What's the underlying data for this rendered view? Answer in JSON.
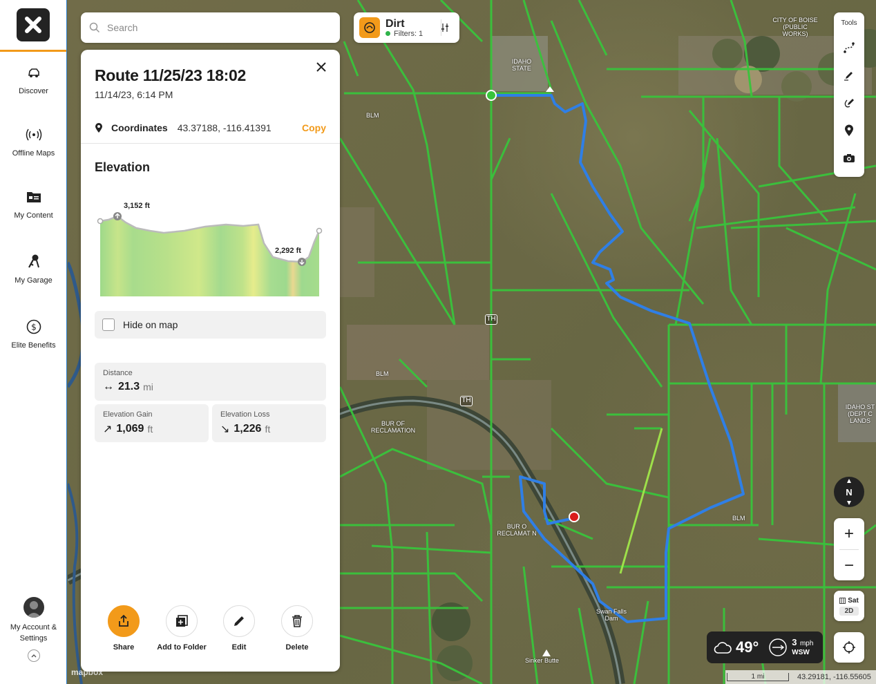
{
  "sidebar": {
    "items": [
      {
        "label": "Discover",
        "icon": "vehicle-discover-icon"
      },
      {
        "label": "Offline Maps",
        "icon": "offline-signal-icon"
      },
      {
        "label": "My Content",
        "icon": "folder-content-icon"
      },
      {
        "label": "My Garage",
        "icon": "keys-garage-icon"
      },
      {
        "label": "Elite Benefits",
        "icon": "dollar-circle-icon"
      }
    ],
    "account_label": "My Account & Settings"
  },
  "search": {
    "placeholder": "Search"
  },
  "filter": {
    "title": "Dirt",
    "subtitle": "Filters: 1",
    "accent": "#f29a1a"
  },
  "route": {
    "title": "Route 11/25/23 18:02",
    "date": "11/14/23, 6:14 PM",
    "coords_label": "Coordinates",
    "coords_value": "43.37188, -116.41391",
    "copy_label": "Copy",
    "elevation_heading": "Elevation",
    "elev_max": "3,152 ft",
    "elev_min": "2,292 ft",
    "hide_label": "Hide on map",
    "distance_label": "Distance",
    "distance_value": "21.3",
    "distance_unit": "mi",
    "gain_label": "Elevation Gain",
    "gain_value": "1,069",
    "gain_unit": "ft",
    "loss_label": "Elevation Loss",
    "loss_value": "1,226",
    "loss_unit": "ft"
  },
  "actions": [
    {
      "label": "Share"
    },
    {
      "label": "Add to Folder"
    },
    {
      "label": "Edit"
    },
    {
      "label": "Delete"
    }
  ],
  "tools": {
    "label": "Tools"
  },
  "map_controls": {
    "compass": "N",
    "sat_label": "Sat",
    "mode_label": "2D",
    "zoom_in": "+",
    "zoom_out": "−"
  },
  "weather": {
    "temp": "49°",
    "wind_speed": "3",
    "wind_unit": "mph",
    "wind_dir": "WSW"
  },
  "scale": {
    "label": "1 mi",
    "coords": "43.29181, -116.55605"
  },
  "map_labels": {
    "idaho_state": "IDAHO STATE",
    "boise": "CITY OF BOISE (PUBLIC WORKS)",
    "blm1": "BLM",
    "blm2": "BLM",
    "blm3": "BLM",
    "bur1": "BUR OF RECLAMATION",
    "bur2": "BUR O RECLAMAT N",
    "idaho_st": "IDAHO ST (DEPT C LANDS",
    "sinker": "Sinker Butte",
    "swan": "Swan Falls Dam",
    "th": "TH",
    "mapbox": "mapbox"
  },
  "colors": {
    "route": "#2f7fe6",
    "trail": "#39c43c",
    "brand": "#f29a1a"
  }
}
